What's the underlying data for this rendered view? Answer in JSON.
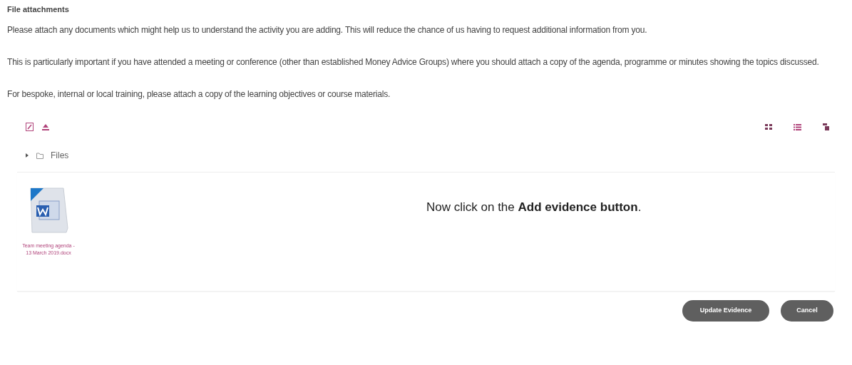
{
  "heading": "File attachments",
  "paragraphs": [
    "Please attach any documents which might help us to understand the activity you are adding. This will reduce the chance of us having to request additional information from you.",
    "This is particularly important if you have attended a meeting or conference (other than established Money Advice Groups) where you should attach a copy of the agenda, programme or minutes showing the topics discussed.",
    "For bespoke, internal or local training, please attach a copy of the learning objectives or course materials."
  ],
  "tree": {
    "label": "Files",
    "expanded": false
  },
  "files": [
    {
      "name": "Team meeting agenda - 13 March 2019.docx"
    }
  ],
  "instruction": "Now click on the **Add evidence button**.",
  "buttons": [
    "Update Evidence",
    "Cancel"
  ]
}
